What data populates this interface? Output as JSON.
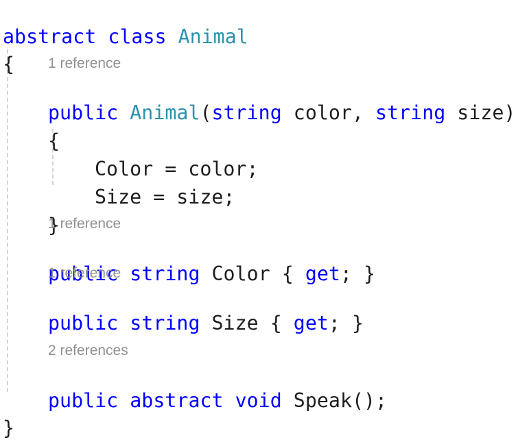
{
  "editor": {
    "class_decl": {
      "modifier": "abstract",
      "keyword": "class",
      "name": "Animal"
    },
    "open_brace": "{",
    "close_brace": "}",
    "constructor": {
      "codelens": "1 reference",
      "access": "public",
      "name": "Animal",
      "paren_open": "(",
      "param1_type": "string",
      "param1_name": " color, ",
      "param2_type": "string",
      "param2_name": " size)",
      "open_brace": "{",
      "stmt1": "Color = color;",
      "stmt2": "Size = size;",
      "close_brace": "}"
    },
    "prop_color": {
      "codelens": "1 reference",
      "access": "public",
      "type": "string",
      "name": " Color { ",
      "accessor": "get",
      "tail": "; }"
    },
    "prop_size": {
      "codelens": "1 reference",
      "access": "public",
      "type": "string",
      "name": " Size { ",
      "accessor": "get",
      "tail": "; }"
    },
    "method_speak": {
      "codelens": "2 references",
      "access": "public",
      "modifier": "abstract",
      "return_type": "void",
      "signature": " Speak();"
    }
  },
  "colors": {
    "keyword": "#0000ff",
    "type_name": "#2b91af",
    "plain_text": "#1e1e1e",
    "codelens": "#919191",
    "indent_guide": "#d4d4d4"
  }
}
